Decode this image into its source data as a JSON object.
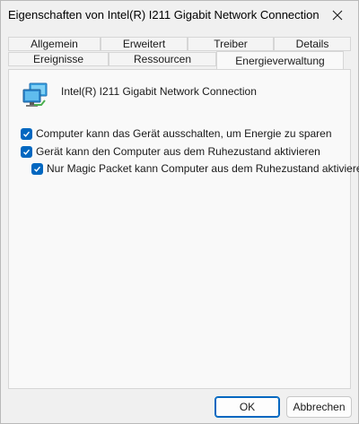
{
  "window": {
    "title": "Eigenschaften von Intel(R) I211 Gigabit Network Connection"
  },
  "tabs": {
    "row1": [
      "Allgemein",
      "Erweitert",
      "Treiber",
      "Details"
    ],
    "row2": [
      "Ereignisse",
      "Ressourcen",
      "Energieverwaltung"
    ],
    "active": "Energieverwaltung"
  },
  "device": {
    "name": "Intel(R) I211 Gigabit Network Connection",
    "icon": "network-adapter-icon"
  },
  "options": [
    {
      "label": "Computer kann das Gerät ausschalten, um Energie zu sparen",
      "checked": true
    },
    {
      "label": "Gerät kann den Computer aus dem Ruhezustand aktivieren",
      "checked": true
    },
    {
      "label": "Nur Magic Packet kann Computer aus dem Ruhezustand aktivieren",
      "checked": true
    }
  ],
  "buttons": {
    "ok": "OK",
    "cancel": "Abbrechen"
  },
  "colors": {
    "accent": "#0067c0",
    "panel_bg": "#f9f9f9",
    "window_bg": "#f0f0f0"
  }
}
